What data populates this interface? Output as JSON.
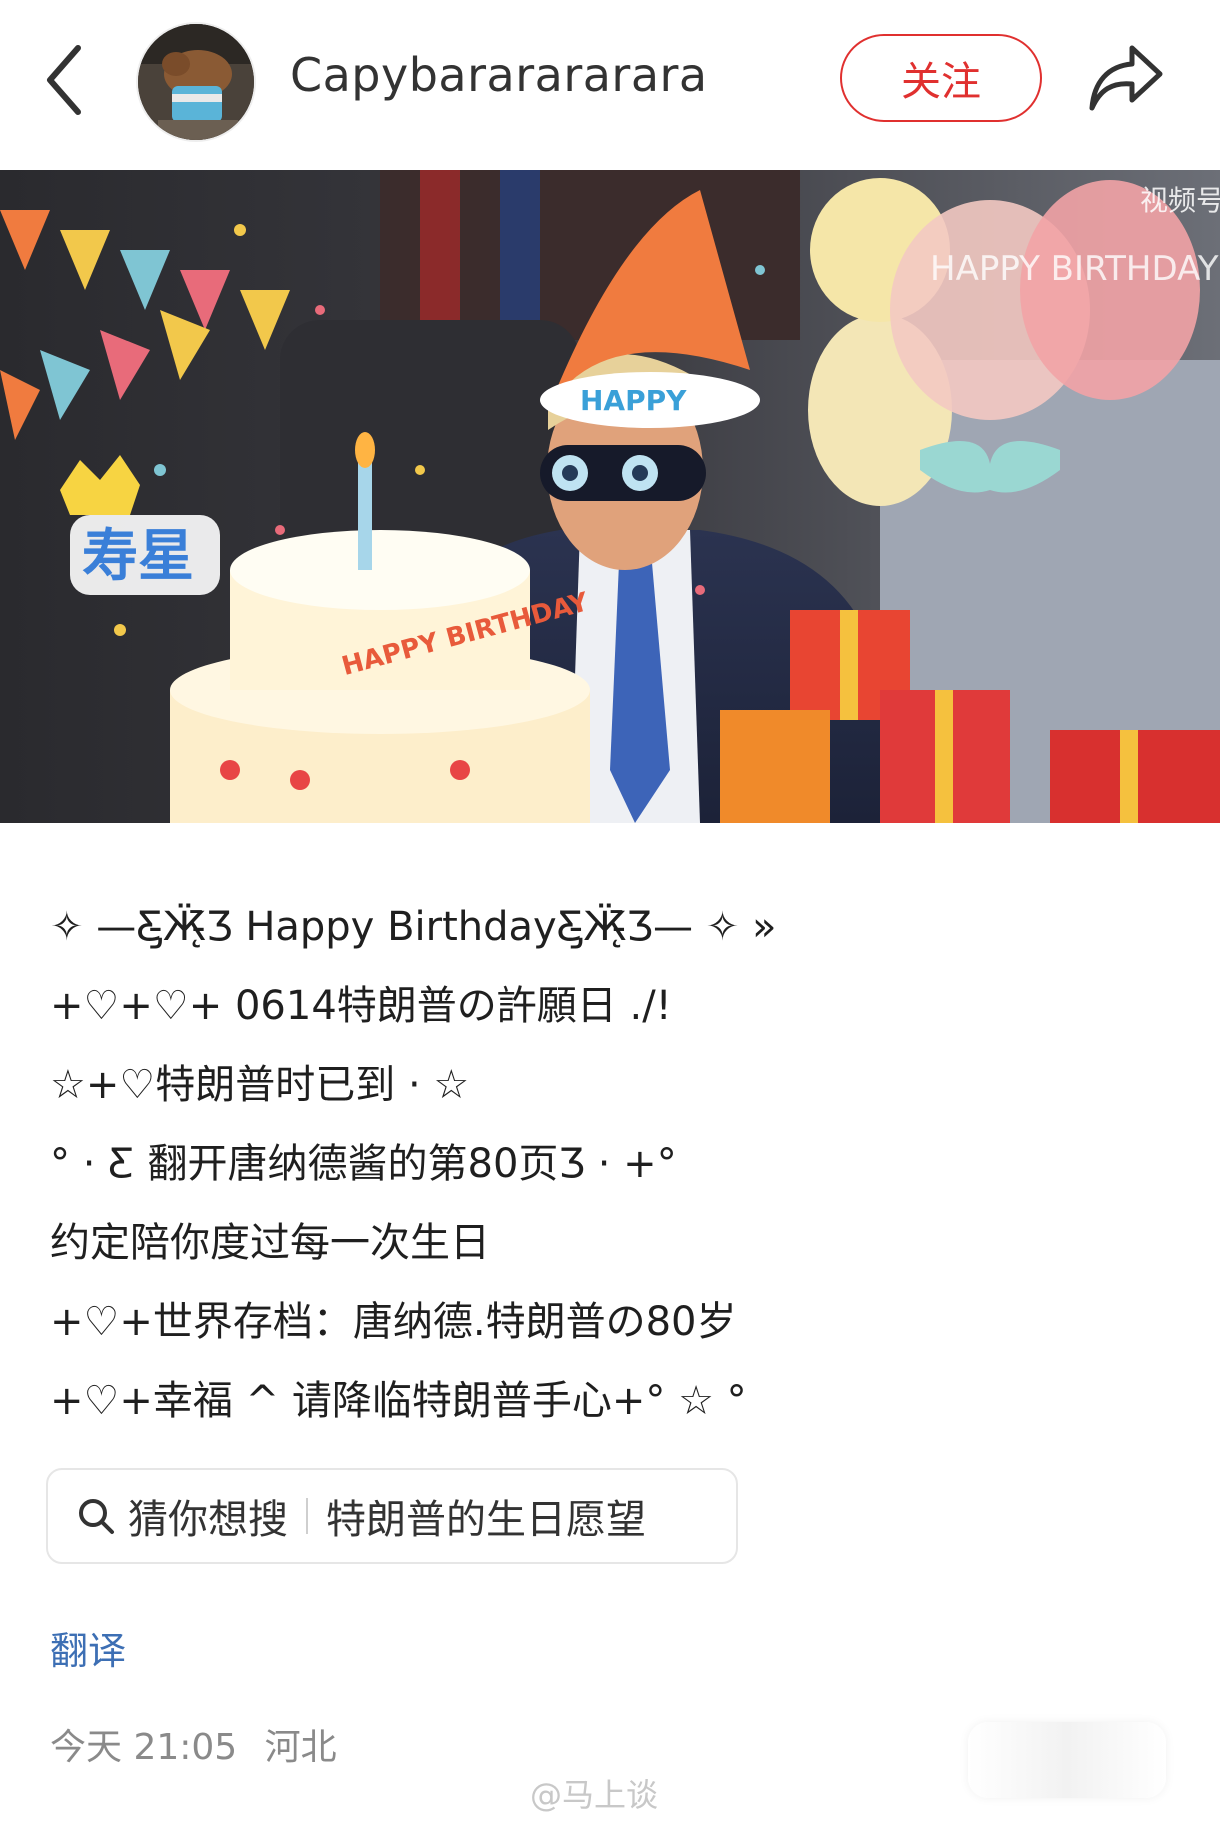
{
  "header": {
    "username": "Capybararararara",
    "follow_label": "关注"
  },
  "media": {
    "overlay_texts": [
      "HAPPY",
      "HAPPY BIRTHDAY",
      "HAPPY BIRTHDAY",
      "寿星",
      "视频号"
    ]
  },
  "caption": {
    "lines": [
      "✧ —Ƹ̵̡Ӝ̵̨̄Ʒ Happy BirthdayƸ̵̡Ӝ̵̨̄Ʒ— ✧ »",
      "+♡+♡+ 0614特朗普の許願日 ./!",
      "☆+♡特朗普时已到 · ☆",
      "°  · Ƹ 翻开唐纳德酱的第80页Ʒ  · +°",
      "约定陪你度过每一次生日",
      "+♡+世界存档：唐纳德.特朗普の80岁",
      "+♡+幸福 ^ 请降临特朗普手心+°  ☆ °"
    ]
  },
  "suggestion": {
    "label": "猜你想搜",
    "query": "特朗普的生日愿望"
  },
  "translate_label": "翻译",
  "meta": {
    "time": "今天 21:05",
    "location": "河北"
  },
  "watermark": "@马上谈",
  "colors": {
    "accent_red": "#e0302f",
    "link_blue": "#3d6fb4"
  }
}
